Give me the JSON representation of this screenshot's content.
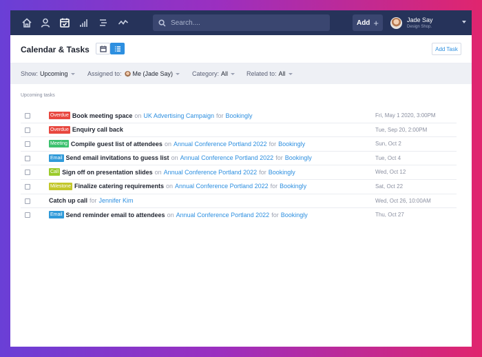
{
  "nav": {
    "icons": [
      "home-icon",
      "user-icon",
      "calendar-check-icon",
      "bar-chart-icon",
      "list-icon",
      "activity-icon"
    ],
    "active": "calendar-check-icon"
  },
  "search": {
    "placeholder": "Search...."
  },
  "add_button": {
    "label": "Add",
    "icon": "plus-icon"
  },
  "user": {
    "name": "Jade Say",
    "subtitle": "Design Shop."
  },
  "page": {
    "title": "Calendar & Tasks",
    "view_buttons": [
      "calendar-view-icon",
      "list-view-icon"
    ],
    "active_view": "list-view-icon",
    "add_task_label": "Add Task"
  },
  "filters": {
    "show": {
      "label": "Show:",
      "value": "Upcoming"
    },
    "assigned": {
      "label": "Assigned to:",
      "value": "Me (Jade Say)"
    },
    "category": {
      "label": "Category:",
      "value": "All"
    },
    "related": {
      "label": "Related to:",
      "value": "All"
    }
  },
  "section_label": "Upcoming tasks",
  "colors": {
    "overdue": "#e8473f",
    "meeting": "#3bc16e",
    "email": "#2f9ad9",
    "call": "#9bcb2b",
    "milestone": "#c3c72a",
    "link": "#2d8fe0",
    "topbar": "#26335a"
  },
  "tasks": [
    {
      "badge": "Overdue",
      "badge_type": "overdue",
      "title": "Book meeting space",
      "on_word": "on",
      "on": "UK Advertising Campaign",
      "for_word": "for",
      "for": "Bookingly",
      "date": "Fri, May 1 2020, 3:00PM"
    },
    {
      "badge": "Overdue",
      "badge_type": "overdue",
      "title": "Enquiry call back",
      "on_word": "",
      "on": "",
      "for_word": "",
      "for": "",
      "date": "Tue, Sep 20, 2:00PM"
    },
    {
      "badge": "Meeting",
      "badge_type": "meeting",
      "title": "Compile guest list of attendees",
      "on_word": "on",
      "on": "Annual Conference Portland 2022",
      "for_word": "for",
      "for": "Bookingly",
      "date": "Sun, Oct 2"
    },
    {
      "badge": "Email",
      "badge_type": "email",
      "title": "Send email invitations to guess list",
      "on_word": "on",
      "on": "Annual Conference Portland 2022",
      "for_word": "for",
      "for": "Bookingly",
      "date": "Tue, Oct 4"
    },
    {
      "badge": "Call",
      "badge_type": "call",
      "title": "Sign off on presentation slides",
      "on_word": "on",
      "on": "Annual Conference Portland 2022",
      "for_word": "for",
      "for": "Bookingly",
      "date": "Wed, Oct 12"
    },
    {
      "badge": "Milestone",
      "badge_type": "milestone",
      "title": "Finalize catering requirements",
      "on_word": "on",
      "on": "Annual Conference Portland 2022",
      "for_word": "for",
      "for": "Bookingly",
      "date": "Sat, Oct 22"
    },
    {
      "badge": "",
      "badge_type": "",
      "title": "Catch up call",
      "on_word": "",
      "on": "",
      "for_word": "for",
      "for": "Jennifer Kim",
      "date": "Wed, Oct 26, 10:00AM"
    },
    {
      "badge": "Email",
      "badge_type": "email",
      "title": "Send reminder email to attendees",
      "on_word": "on",
      "on": "Annual Conference Portland 2022",
      "for_word": "for",
      "for": "Bookingly",
      "date": "Thu, Oct 27"
    }
  ]
}
